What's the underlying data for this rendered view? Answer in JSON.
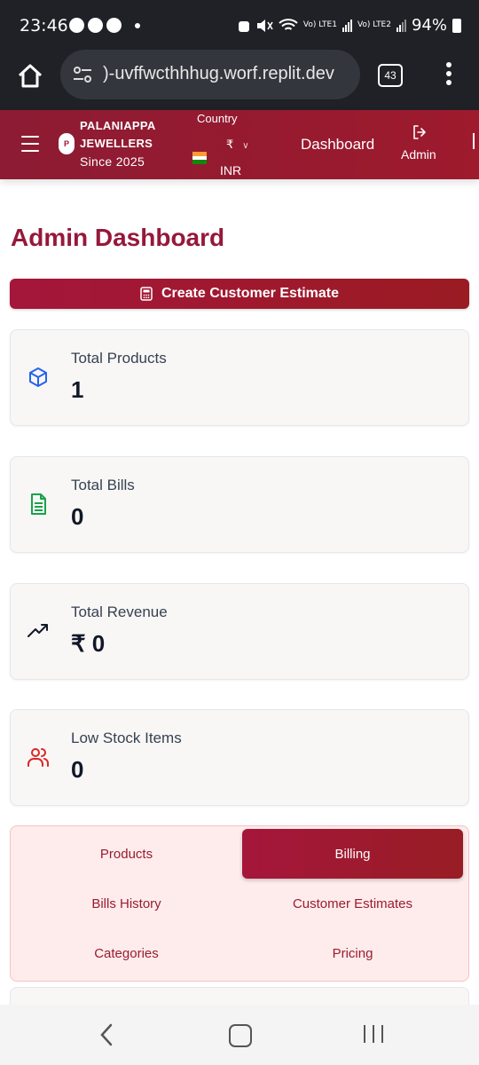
{
  "status_bar": {
    "time": "23:46",
    "battery": "94%",
    "sim1": "Vo) LTE1",
    "sim2": "Vo) LTE2"
  },
  "browser": {
    "url": ")-uvffwcthhhug.worf.replit.dev",
    "tab_count": "43"
  },
  "header": {
    "brand_line1": "PALANIAPPA",
    "brand_line2": "JEWELLERS",
    "brand_since": "Since 2025",
    "logo_letter": "P",
    "country_label": "Country",
    "currency_symbol": "₹",
    "currency_code": "INR",
    "nav_dashboard": "Dashboard",
    "nav_admin": "Admin"
  },
  "main": {
    "title": "Admin Dashboard",
    "estimate_button": "Create Customer Estimate",
    "stats": [
      {
        "label": "Total Products",
        "value": "1",
        "icon": "cube-icon",
        "color": "#2563eb"
      },
      {
        "label": "Total Bills",
        "value": "0",
        "icon": "document-icon",
        "color": "#16a34a"
      },
      {
        "label": "Total Revenue",
        "value": "₹ 0",
        "icon": "trending-up-icon",
        "color": "#111827"
      },
      {
        "label": "Low Stock Items",
        "value": "0",
        "icon": "users-icon",
        "color": "#dc2626"
      }
    ],
    "menu": [
      {
        "label": "Products",
        "active": false
      },
      {
        "label": "Billing",
        "active": true
      },
      {
        "label": "Bills History",
        "active": false
      },
      {
        "label": "Customer Estimates",
        "active": false
      },
      {
        "label": "Categories",
        "active": false
      },
      {
        "label": "Pricing",
        "active": false
      }
    ]
  },
  "colors": {
    "brand": "#96183a",
    "header_bg": "#8c1b33",
    "menu_bg": "#feecec"
  }
}
